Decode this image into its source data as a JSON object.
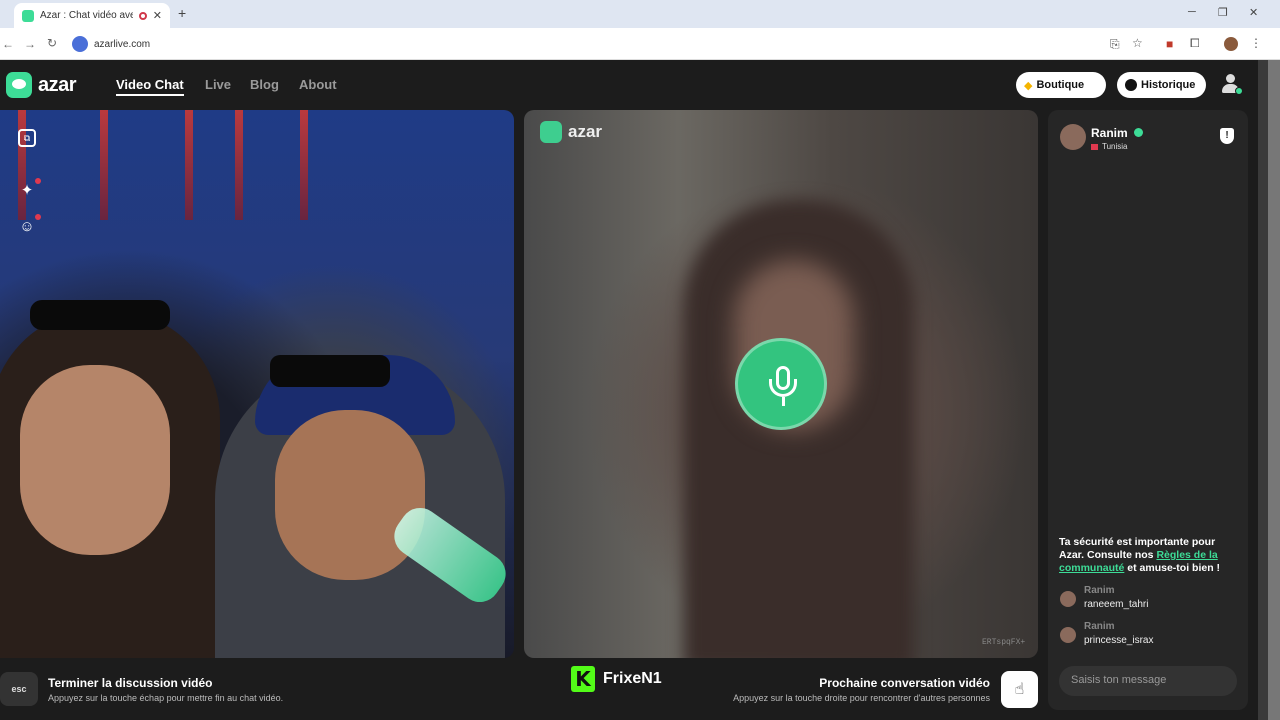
{
  "browser": {
    "tab_title": "Azar : Chat vidéo avec de n",
    "tab_close": "✕",
    "new_tab": "+",
    "minimize": "─",
    "restore": "❐",
    "close": "✕",
    "back": "←",
    "forward": "→",
    "reload": "↻",
    "url": "azarlive.com"
  },
  "header": {
    "logo_text": "azar",
    "nav": [
      "Video Chat",
      "Live",
      "Blog",
      "About"
    ],
    "shop_label": "Boutique",
    "history_label": "Historique",
    "gem_icon": "◆"
  },
  "left_tools": {
    "window_icon": "⧉",
    "sparkle_icon": "✦",
    "emoji_icon": "☺"
  },
  "stream": {
    "overlay_logo": "azar",
    "watermark": "ERTspqFX+",
    "streamer_badge": "K",
    "streamer_name": "FrixeN1"
  },
  "chat": {
    "partner_name": "Ranim",
    "partner_country": "Tunisia",
    "shield_glyph": "!",
    "safety_text_1": "Ta sécurité est importante pour Azar. Consulte nos ",
    "safety_link": "Règles de la communauté",
    "safety_text_2": " et amuse-toi bien !",
    "messages": [
      {
        "sender": "Ranim",
        "text": "raneeem_tahri"
      },
      {
        "sender": "Ranim",
        "text": "princesse_israx"
      }
    ],
    "input_placeholder": "Saisis ton message"
  },
  "footer": {
    "esc_key": "esc",
    "end_title": "Terminer la discussion vidéo",
    "end_sub": "Appuyez sur la touche échap pour mettre fin au chat vidéo.",
    "next_title": "Prochaine conversation vidéo",
    "next_sub": "Appuyez sur la touche droite pour rencontrer d'autres personnes",
    "next_key_glyph": "☝"
  }
}
